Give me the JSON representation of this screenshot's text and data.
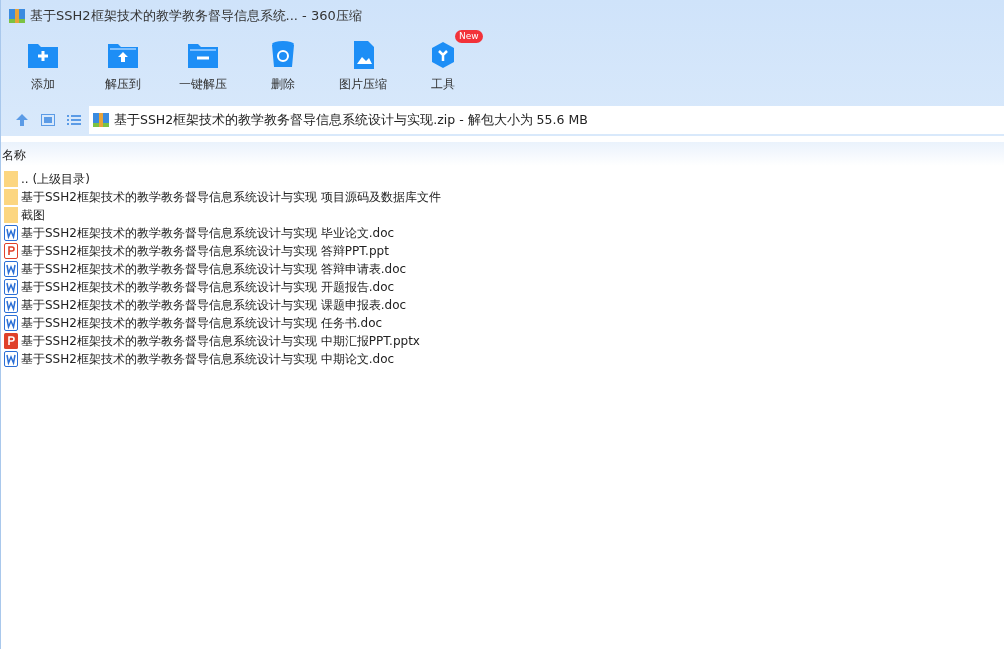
{
  "window": {
    "title": "基于SSH2框架技术的教学教务督导信息系统... - 360压缩"
  },
  "toolbar": [
    {
      "kind": "add",
      "label": "添加"
    },
    {
      "kind": "extract",
      "label": "解压到"
    },
    {
      "kind": "oneclick",
      "label": "一键解压"
    },
    {
      "kind": "delete",
      "label": "删除"
    },
    {
      "kind": "image",
      "label": "图片压缩"
    },
    {
      "kind": "tools",
      "label": "工具",
      "badge": "New"
    }
  ],
  "address": {
    "path": "基于SSH2框架技术的教学教务督导信息系统设计与实现.zip - 解包大小为 55.6 MB"
  },
  "list": {
    "columns": [
      "名称"
    ],
    "rows": [
      {
        "kind": "folder",
        "name": ".. (上级目录)"
      },
      {
        "kind": "folder",
        "name": "基于SSH2框架技术的教学教务督导信息系统设计与实现 项目源码及数据库文件"
      },
      {
        "kind": "folder",
        "name": "截图"
      },
      {
        "kind": "doc",
        "name": "基于SSH2框架技术的教学教务督导信息系统设计与实现 毕业论文.doc"
      },
      {
        "kind": "ppt",
        "name": "基于SSH2框架技术的教学教务督导信息系统设计与实现 答辩PPT.ppt"
      },
      {
        "kind": "doc",
        "name": "基于SSH2框架技术的教学教务督导信息系统设计与实现 答辩申请表.doc"
      },
      {
        "kind": "doc",
        "name": "基于SSH2框架技术的教学教务督导信息系统设计与实现 开题报告.doc"
      },
      {
        "kind": "doc",
        "name": "基于SSH2框架技术的教学教务督导信息系统设计与实现 课题申报表.doc"
      },
      {
        "kind": "doc",
        "name": "基于SSH2框架技术的教学教务督导信息系统设计与实现 任务书.doc"
      },
      {
        "kind": "pptx",
        "name": "基于SSH2框架技术的教学教务督导信息系统设计与实现 中期汇报PPT.pptx"
      },
      {
        "kind": "doc",
        "name": "基于SSH2框架技术的教学教务督导信息系统设计与实现 中期论文.doc"
      }
    ]
  }
}
